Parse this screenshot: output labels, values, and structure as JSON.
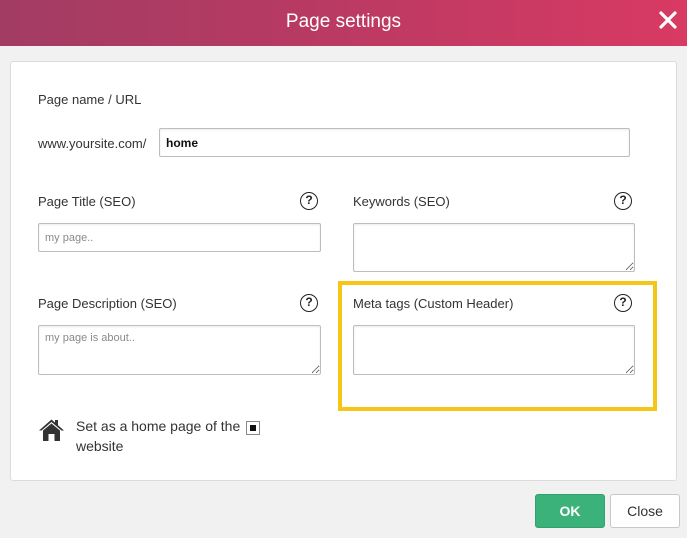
{
  "dialog": {
    "title": "Page settings",
    "close_icon": "close-x-icon"
  },
  "form": {
    "page_name_label": "Page name / URL",
    "url_prefix": "www.yoursite.com/",
    "url_value": "home",
    "page_title_label": "Page Title (SEO)",
    "page_title_placeholder": "my page..",
    "keywords_label": "Keywords (SEO)",
    "keywords_value": "",
    "page_description_label": "Page Description (SEO)",
    "page_description_placeholder": "my page is about..",
    "meta_tags_label": "Meta tags (Custom Header)",
    "meta_tags_value": "",
    "help_glyph": "?",
    "home_page_label": "Set as a home page of the website",
    "home_page_checked": true
  },
  "footer": {
    "ok_label": "OK",
    "close_label": "Close"
  },
  "colors": {
    "header_gradient_start": "#a23c63",
    "header_gradient_end": "#d83a63",
    "ok_button": "#3ab27a",
    "highlight": "#f5c518"
  }
}
